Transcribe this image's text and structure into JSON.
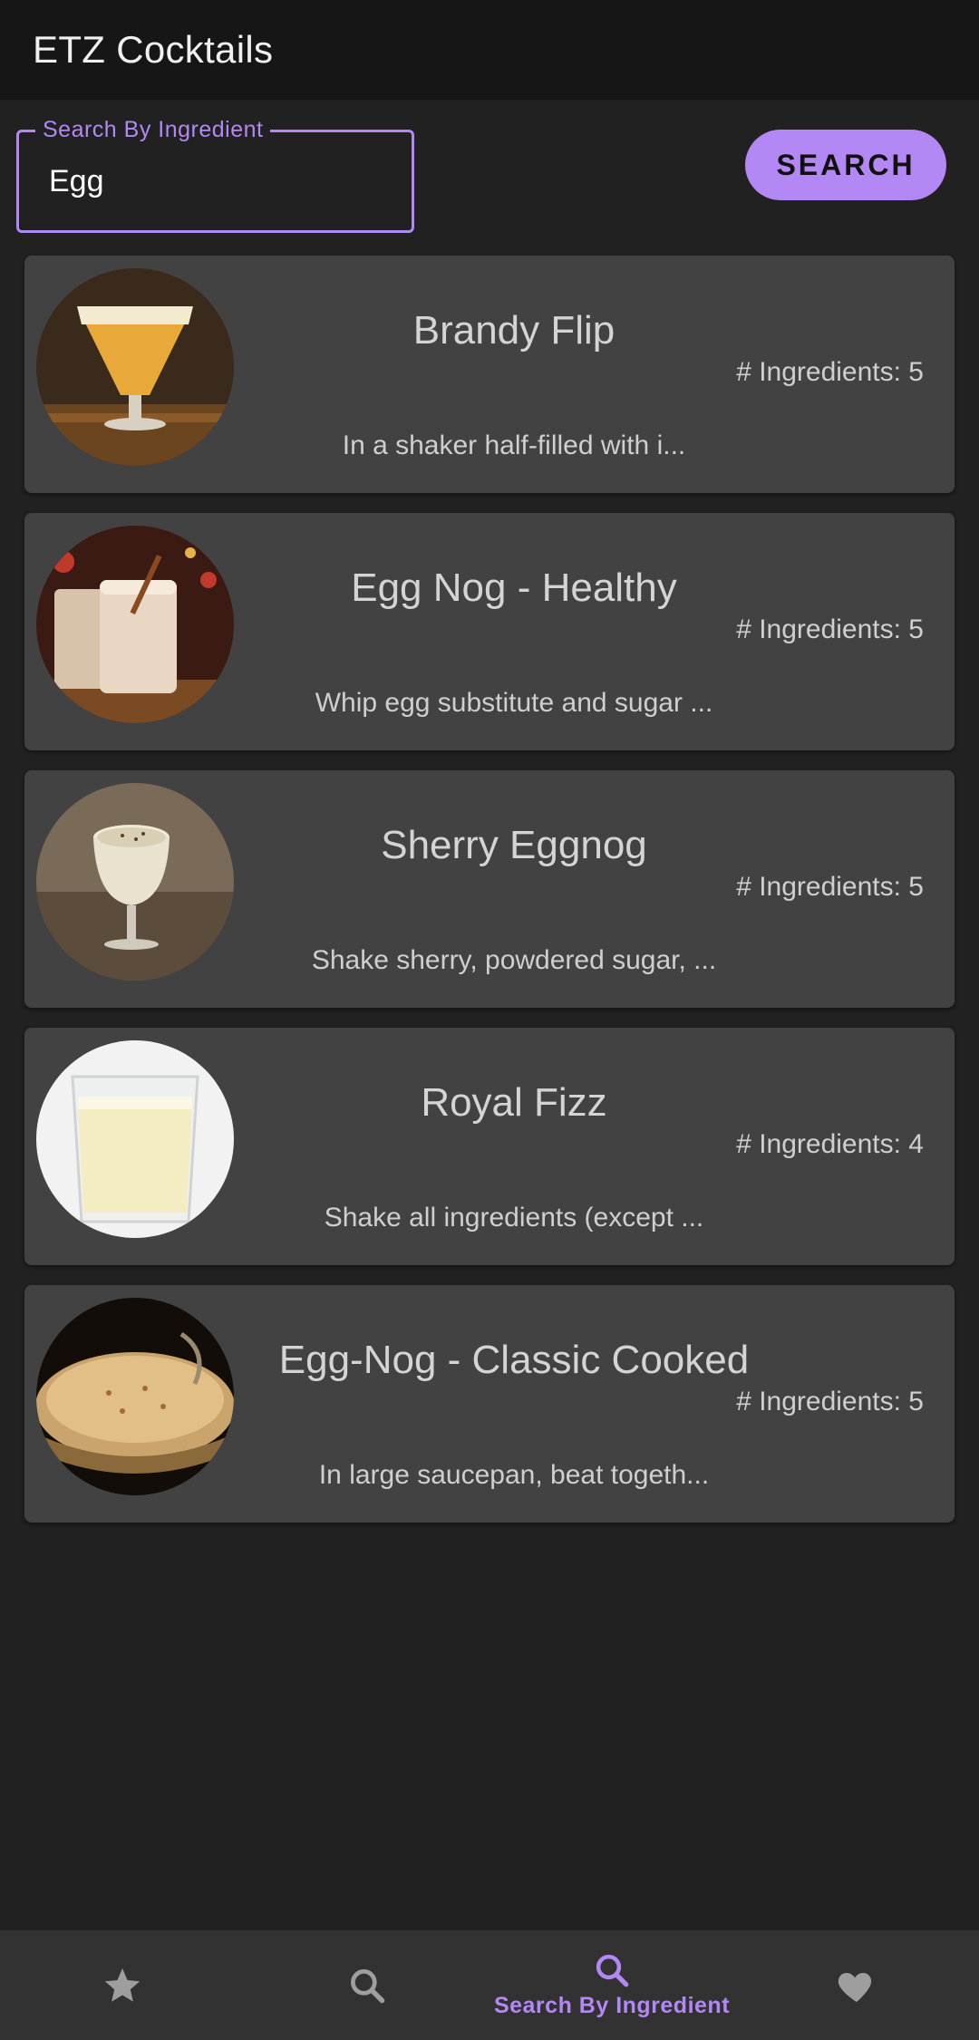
{
  "app": {
    "title": "ETZ Cocktails"
  },
  "search": {
    "label": "Search By Ingredient",
    "value": "Egg",
    "button_label": "SEARCH"
  },
  "results": [
    {
      "name": "Brandy Flip",
      "ingredients": "# Ingredients: 5",
      "description": "In a shaker half-filled with i...",
      "image": "brandy-flip-photo"
    },
    {
      "name": "Egg Nog - Healthy",
      "ingredients": "# Ingredients: 5",
      "description": "Whip egg substitute and sugar ...",
      "image": "egg-nog-healthy-photo"
    },
    {
      "name": "Sherry Eggnog",
      "ingredients": "# Ingredients: 5",
      "description": "Shake sherry, powdered sugar, ...",
      "image": "sherry-eggnog-photo"
    },
    {
      "name": "Royal Fizz",
      "ingredients": "# Ingredients: 4",
      "description": "Shake all ingredients (except ...",
      "image": "royal-fizz-photo"
    },
    {
      "name": "Egg-Nog - Classic Cooked",
      "ingredients": "# Ingredients: 5",
      "description": "In large saucepan, beat togeth...",
      "image": "egg-nog-classic-cooked-photo"
    }
  ],
  "bottom_nav": {
    "items": [
      {
        "icon": "star-icon",
        "label": ""
      },
      {
        "icon": "search-icon",
        "label": ""
      },
      {
        "icon": "search-icon",
        "label": "Search By Ingredient",
        "active": true
      },
      {
        "icon": "heart-icon",
        "label": ""
      }
    ]
  },
  "colors": {
    "accent": "#b388f5",
    "background": "#212121",
    "appbar": "#161616",
    "card": "#424242",
    "nav": "#323232"
  }
}
